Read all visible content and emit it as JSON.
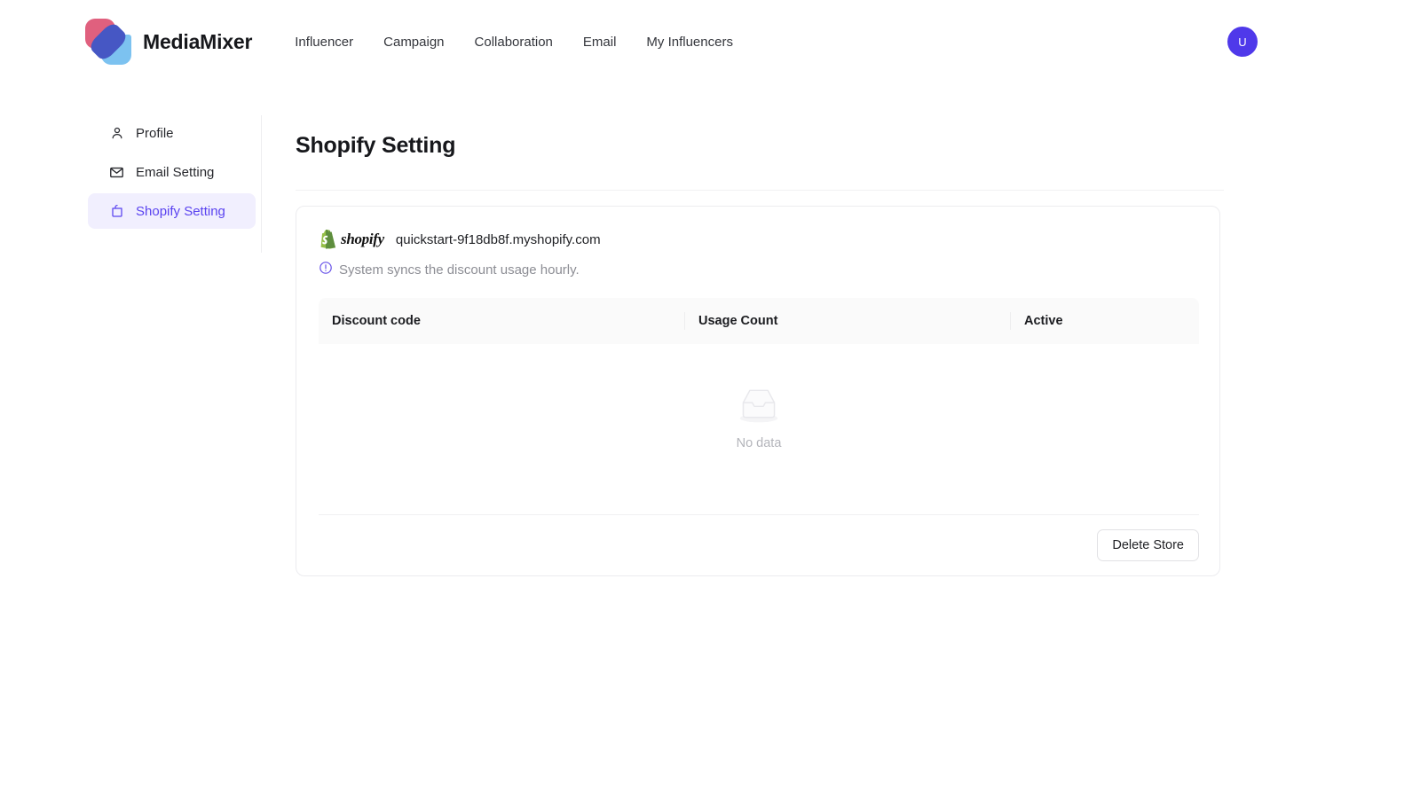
{
  "header": {
    "brand_name": "MediaMixer",
    "logo_icon": "mediamixer-logo",
    "nav_items": [
      {
        "label": "Influencer"
      },
      {
        "label": "Campaign"
      },
      {
        "label": "Collaboration"
      },
      {
        "label": "Email"
      },
      {
        "label": "My Influencers"
      }
    ],
    "avatar_initial": "U",
    "avatar_color": "#4f39ea"
  },
  "sidebar": {
    "items": [
      {
        "label": "Profile",
        "icon": "user-icon",
        "active": false
      },
      {
        "label": "Email Setting",
        "icon": "envelope-icon",
        "active": false
      },
      {
        "label": "Shopify Setting",
        "icon": "shopping-bag-icon",
        "active": true
      }
    ],
    "active_color": "#5a43f0",
    "active_bg": "#f1effe"
  },
  "main": {
    "page_title": "Shopify Setting",
    "store": {
      "logo_icon": "shopify-logo",
      "logo_word": "shopify",
      "url": "quickstart-9f18db8f.myshopify.com",
      "logo_color": "#7ab55c"
    },
    "notice": {
      "icon": "exclamation-circle-icon",
      "text": "System syncs the discount usage hourly.",
      "icon_color": "#6650e8"
    },
    "table": {
      "columns": [
        "Discount code",
        "Usage Count",
        "Active"
      ],
      "rows": [],
      "empty_state": {
        "icon": "empty-inbox-icon",
        "label": "No data"
      }
    },
    "footer": {
      "delete_button_label": "Delete Store"
    }
  }
}
